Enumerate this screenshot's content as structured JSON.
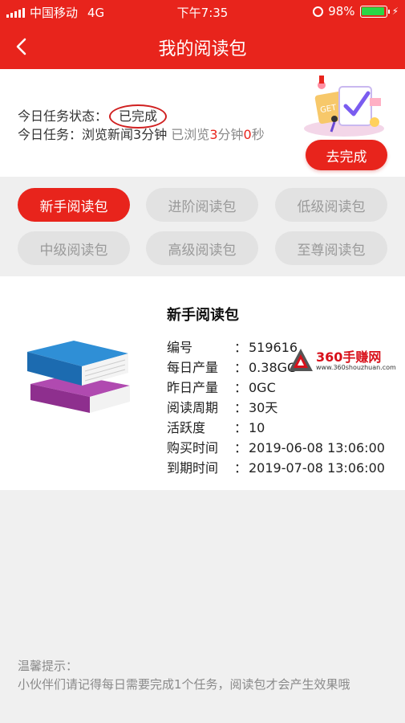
{
  "status_bar": {
    "carrier": "中国移动",
    "network": "4G",
    "time": "下午7:35",
    "battery": "98%",
    "battery_level": 0.98
  },
  "nav": {
    "title": "我的阅读包"
  },
  "task": {
    "status_label": "今日任务状态：",
    "status_value": "已完成",
    "task_label": "今日任务：",
    "task_desc": "浏览新闻3分钟",
    "progress_prefix": "已浏览",
    "progress_min": "3",
    "progress_min_unit": "分钟",
    "progress_sec": "0",
    "progress_sec_unit": "秒",
    "go_button": "去完成"
  },
  "tabs": [
    {
      "label": "新手阅读包",
      "active": true
    },
    {
      "label": "进阶阅读包",
      "active": false
    },
    {
      "label": "低级阅读包",
      "active": false
    },
    {
      "label": "中级阅读包",
      "active": false
    },
    {
      "label": "高级阅读包",
      "active": false
    },
    {
      "label": "至尊阅读包",
      "active": false
    }
  ],
  "package": {
    "title": "新手阅读包",
    "rows": [
      {
        "key": "编号",
        "value": "519616"
      },
      {
        "key": "每日产量",
        "value": "0.38GC"
      },
      {
        "key": "昨日产量",
        "value": "0GC"
      },
      {
        "key": "阅读周期",
        "value": "30天"
      },
      {
        "key": "活跃度",
        "value": "10"
      },
      {
        "key": "购买时间",
        "value": "2019-06-08 13:06:00"
      },
      {
        "key": "到期时间",
        "value": "2019-07-08 13:06:00"
      }
    ],
    "separator": "："
  },
  "watermark": {
    "title": "360手赚网",
    "url": "www.360shouzhuan.com"
  },
  "tip": {
    "heading": "温馨提示：",
    "text": "小伙伴们请记得每日需要完成1个任务，阅读包才会产生效果哦"
  },
  "colors": {
    "accent": "#e8241c",
    "tab_inactive_bg": "#e2e2e2",
    "page_bg": "#f0f0f0"
  }
}
